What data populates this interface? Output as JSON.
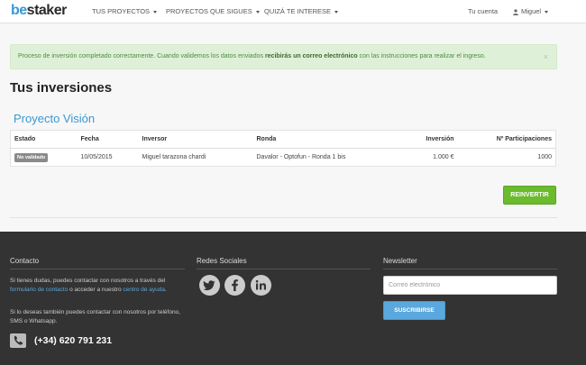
{
  "brand": {
    "logo_accent": "be",
    "logo_rest": "staker"
  },
  "nav": {
    "items": [
      {
        "label": "TUS PROYECTOS"
      },
      {
        "label": "PROYECTOS QUE SIGUES"
      },
      {
        "label": "QUIZÁ TE INTERESE"
      }
    ],
    "account_label": "Tu cuenta",
    "user_label": "Miguel"
  },
  "alert": {
    "text_before": "Proceso de inversión completado correctamente. Cuando validemos los datos enviados ",
    "text_bold": "recibirás un correo electrónico",
    "text_after": " con las instrucciones para realizar el ingreso.",
    "close": "×"
  },
  "page_title": "Tus inversiones",
  "project": {
    "title": "Proyecto Visión",
    "table": {
      "headers": {
        "estado": "Estado",
        "fecha": "Fecha",
        "inversor": "Inversor",
        "ronda": "Ronda",
        "inversion": "Inversión",
        "participaciones": "Nº Participaciones"
      },
      "rows": [
        {
          "estado": "No validado",
          "fecha": "10/05/2015",
          "inversor": "Miguel tarazona chardi",
          "ronda": "Davalor - Optofun - Ronda 1 bis",
          "inversion": "1.000 €",
          "participaciones": "1000"
        }
      ]
    },
    "reinvest_label": "REINVERTIR"
  },
  "footer": {
    "contact": {
      "heading": "Contacto",
      "line1_before": "Si tienes dudas, puedes contactar con nosotros a través del ",
      "link1": "formulario de contacto",
      "line1_mid": " o acceder a nuestro ",
      "link2": "centro de ayuda",
      "line1_end": ".",
      "line2": "Si lo deseas también puedes contactar con nosotros por teléfono, SMS o Whatsapp.",
      "phone": "(+34) 620 791 231"
    },
    "social": {
      "heading": "Redes Sociales"
    },
    "newsletter": {
      "heading": "Newsletter",
      "placeholder": "Correo electrónico",
      "button": "SUSCRIBIRSE"
    }
  },
  "colors": {
    "accent": "#3a97d4",
    "success": "#6bbb2d",
    "footer_bg": "#333333"
  },
  "icons": [
    "caret-down-icon",
    "user-icon",
    "close-icon",
    "phone-icon",
    "twitter-icon",
    "facebook-icon",
    "linkedin-icon"
  ]
}
